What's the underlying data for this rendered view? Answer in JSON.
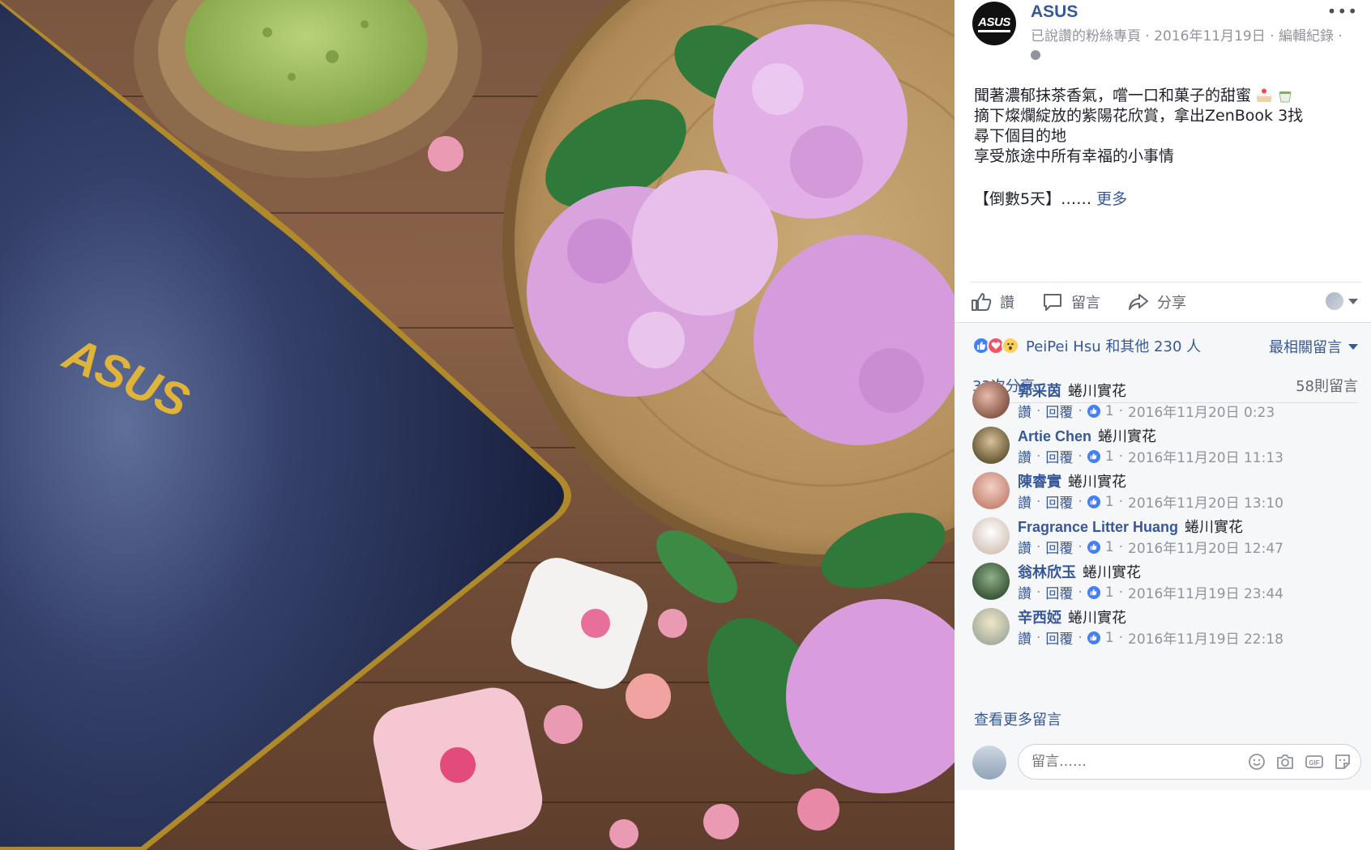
{
  "photo": {
    "laptop_logo": "ASUS"
  },
  "post": {
    "page_avatar_text": "ASUS",
    "page_name": "ASUS",
    "meta": "已說讚的粉絲專頁 · 2016年11月19日 · 編輯紀錄 ·",
    "text_lines": [
      "聞著濃郁抹茶香氣，嚐一口和菓子的甜蜜",
      "摘下燦爛綻放的紫陽花欣賞，拿出ZenBook 3找",
      "尋下個目的地",
      "享受旅途中所有幸福的小事情"
    ],
    "countdown": "【倒數5天】……",
    "see_more": "更多",
    "icons": {
      "more": "more-options-icon",
      "globe": "globe-icon",
      "cake": "cake-emoji-icon",
      "tea": "tea-emoji-icon"
    }
  },
  "actions": {
    "like": "讚",
    "comment": "留言",
    "share": "分享"
  },
  "reactions": {
    "summary": "PeiPei Hsu 和其他 230 人",
    "sort_label": "最相關留言",
    "shares": "33次分享",
    "comment_count": "58則留言"
  },
  "comments": [
    {
      "name": "郭采茵",
      "text": "蜷川實花",
      "like": "讚",
      "reply": "回覆",
      "reactions": "1",
      "time": "2016年11月20日 0:23",
      "avatar_color": "#8a5a4a"
    },
    {
      "name": "Artie Chen",
      "text": "蜷川實花",
      "like": "讚",
      "reply": "回覆",
      "reactions": "1",
      "time": "2016年11月20日 11:13",
      "avatar_color": "#6b5e3a"
    },
    {
      "name": "陳睿實",
      "text": "蜷川實花",
      "like": "讚",
      "reply": "回覆",
      "reactions": "1",
      "time": "2016年11月20日 13:10",
      "avatar_color": "#c98a7a"
    },
    {
      "name": "Fragrance Litter Huang",
      "text": "蜷川實花",
      "like": "讚",
      "reply": "回覆",
      "reactions": "1",
      "time": "2016年11月20日 12:47",
      "avatar_color": "#d8c9bf"
    },
    {
      "name": "翁林欣玉",
      "text": "蜷川實花",
      "like": "讚",
      "reply": "回覆",
      "reactions": "1",
      "time": "2016年11月19日 23:44",
      "avatar_color": "#3d5a3a"
    },
    {
      "name": "辛西婭",
      "text": "蜷川實花",
      "like": "讚",
      "reply": "回覆",
      "reactions": "1",
      "time": "2016年11月19日 22:18",
      "avatar_color": "#a8b2a0"
    }
  ],
  "view_more": "查看更多留言",
  "composer": {
    "placeholder": "留言……"
  },
  "colors": {
    "link": "#365899",
    "meta": "#90949c",
    "like_blue": "#4080ff",
    "love_red": "#f25268",
    "wow_yellow": "#fcd05c"
  }
}
